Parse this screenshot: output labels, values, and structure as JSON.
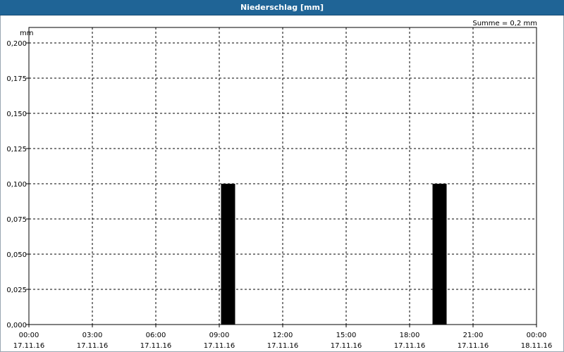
{
  "header": {
    "title": "Niederschlag [mm]"
  },
  "chart_data": {
    "type": "bar",
    "title": "Niederschlag [mm]",
    "ylabel": "mm",
    "summary": "Summe = 0,2 mm",
    "ylim": [
      0,
      0.2
    ],
    "yticks": [
      "0,000",
      "0,025",
      "0,050",
      "0,075",
      "0,100",
      "0,125",
      "0,150",
      "0,175",
      "0,200"
    ],
    "xticks": [
      {
        "time": "00:00",
        "date": "17.11.16"
      },
      {
        "time": "03:00",
        "date": "17.11.16"
      },
      {
        "time": "06:00",
        "date": "17.11.16"
      },
      {
        "time": "09:00",
        "date": "17.11.16"
      },
      {
        "time": "12:00",
        "date": "17.11.16"
      },
      {
        "time": "15:00",
        "date": "17.11.16"
      },
      {
        "time": "18:00",
        "date": "17.11.16"
      },
      {
        "time": "21:00",
        "date": "17.11.16"
      },
      {
        "time": "00:00",
        "date": "18.11.16"
      }
    ],
    "xlim": [
      "17.11.16 00:00",
      "18.11.16 00:00"
    ],
    "bars": [
      {
        "start": "17.11.16 09:05",
        "end": "17.11.16 09:45",
        "value": 0.1
      },
      {
        "start": "17.11.16 19:05",
        "end": "17.11.16 19:45",
        "value": 0.1
      }
    ],
    "bar_color": "#000000",
    "grid": true
  }
}
